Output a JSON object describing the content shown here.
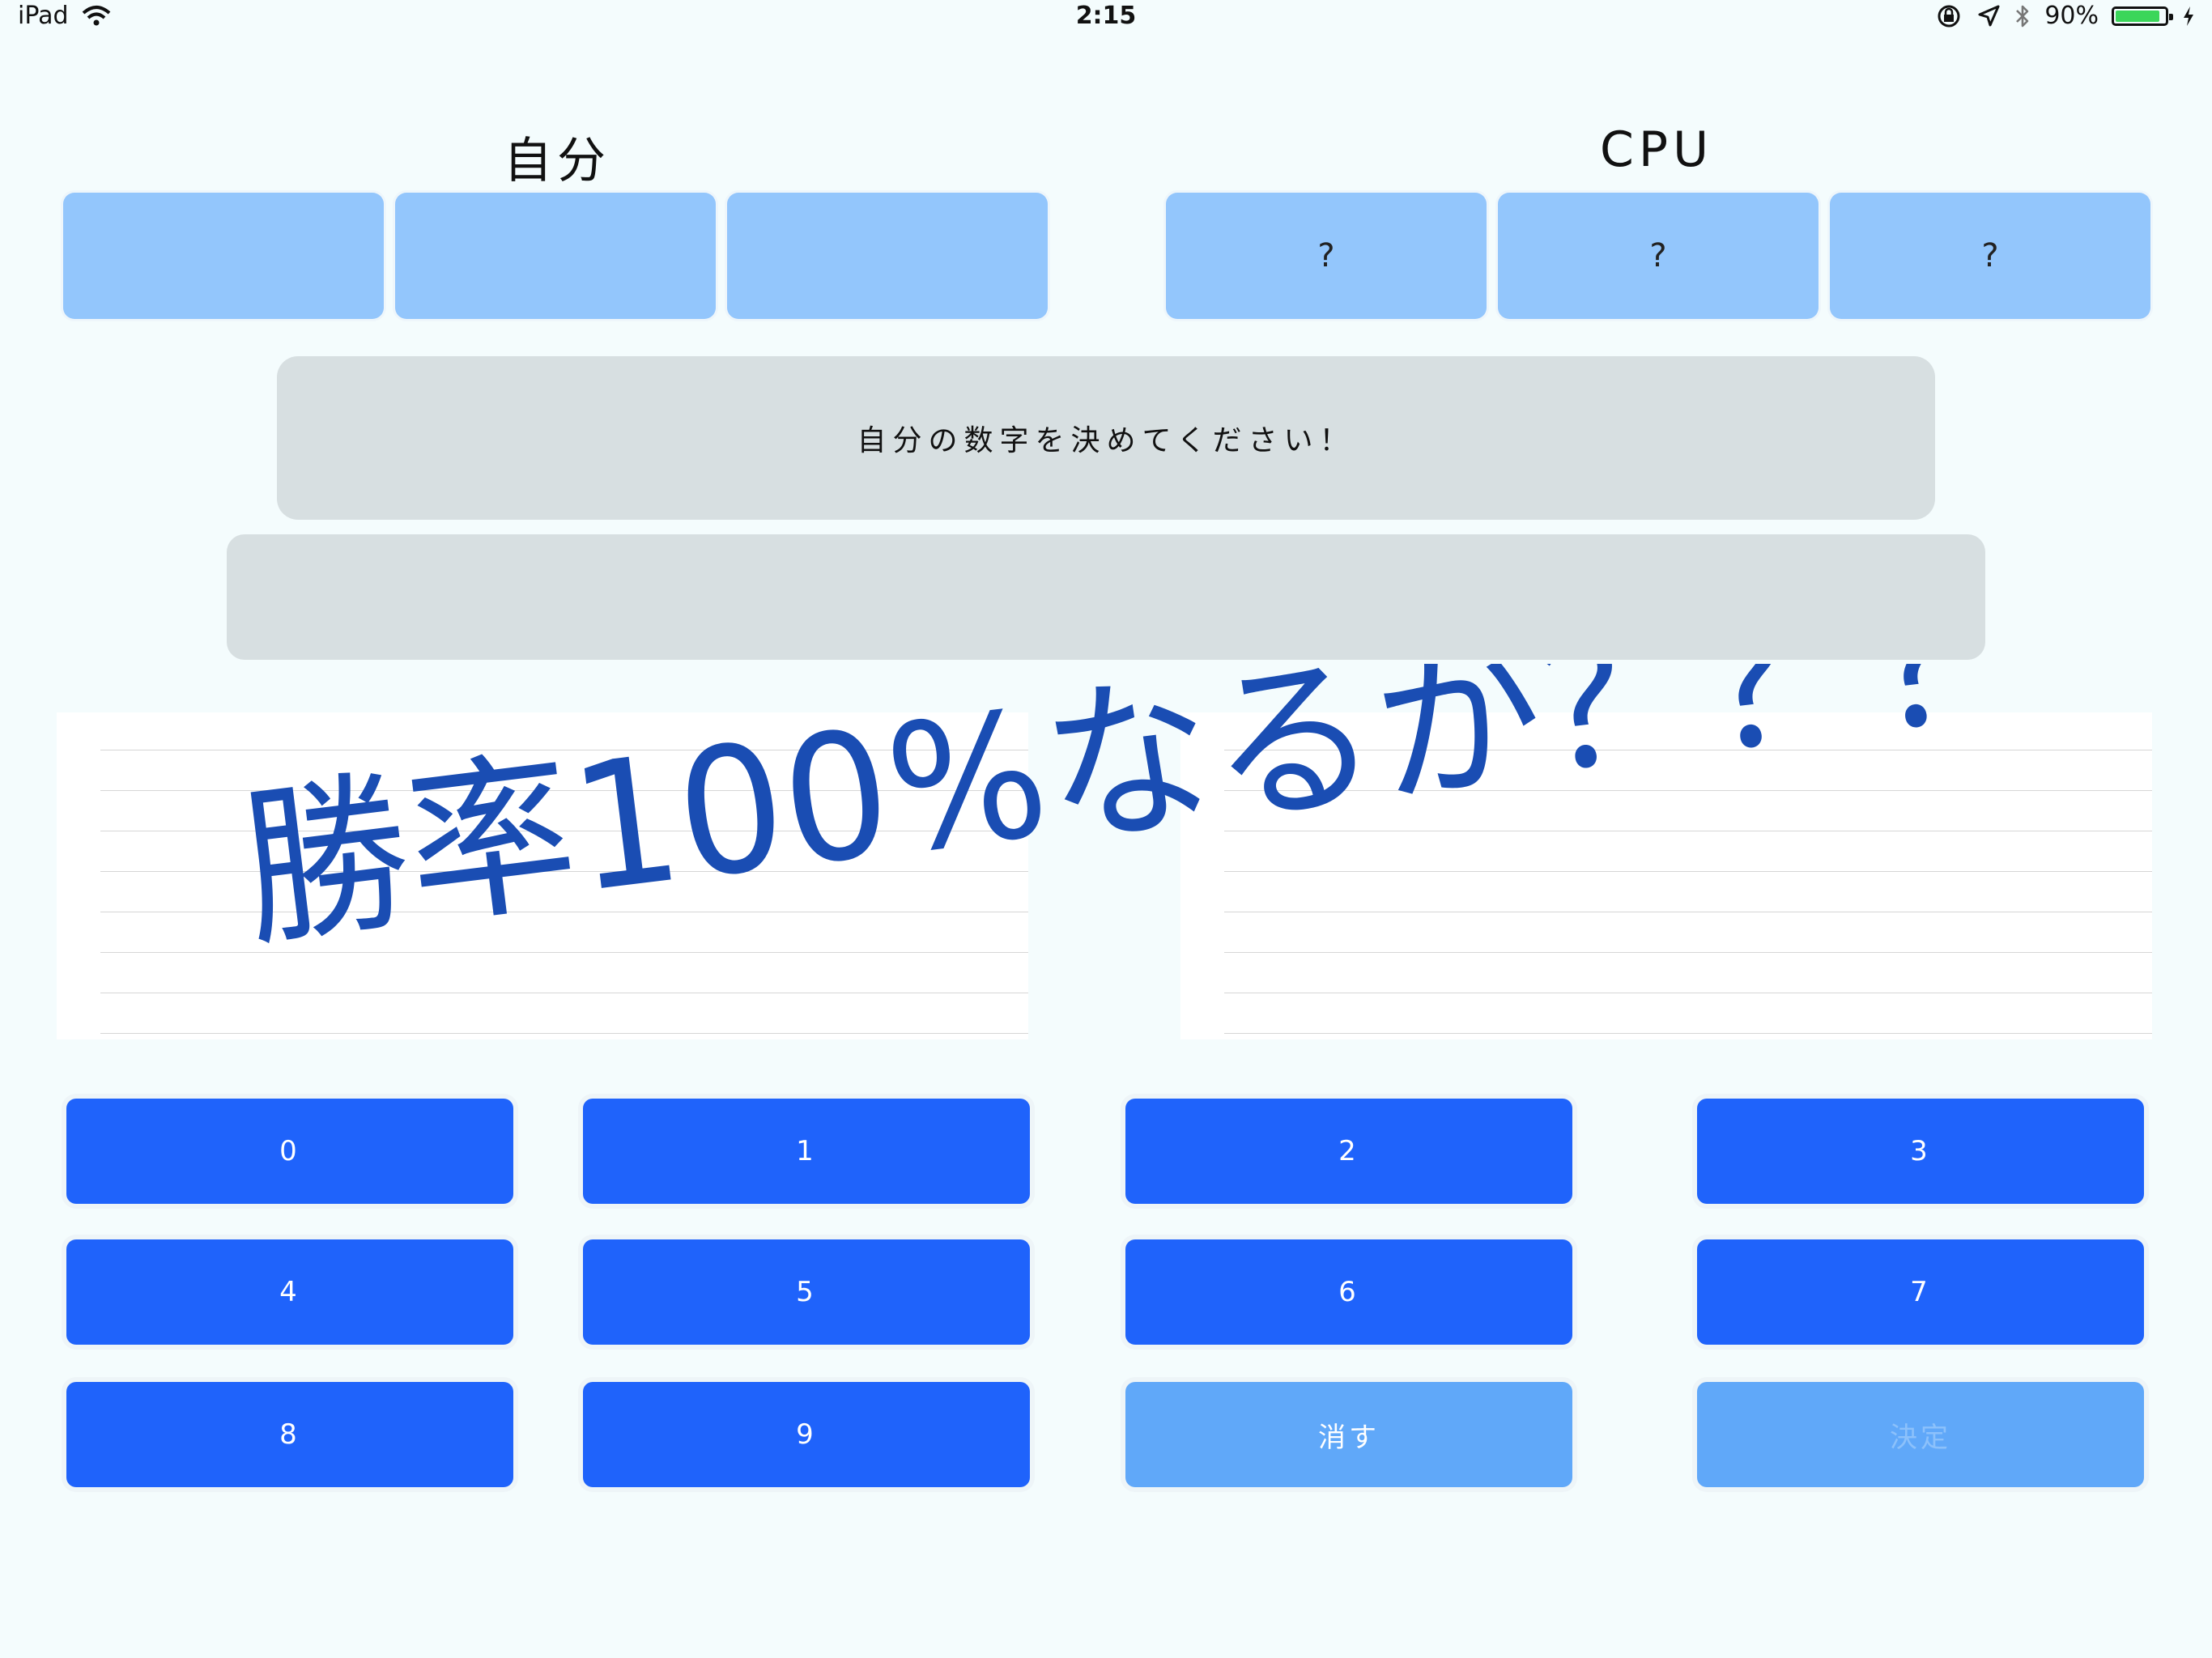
{
  "status_bar": {
    "device": "iPad",
    "time": "2:15",
    "battery": "90%",
    "battery_level": 0.9
  },
  "players": {
    "self_label": "自分",
    "cpu_label": "CPU",
    "self_digits": [
      "",
      "",
      ""
    ],
    "cpu_digits": [
      "?",
      "?",
      "?"
    ]
  },
  "messages": {
    "instruction": "自分の数字を決めてください！",
    "secondary": ""
  },
  "banner": {
    "text": "勝率100%なるか？？？",
    "color": "#1a4db3"
  },
  "keypad": {
    "keys": [
      "0",
      "1",
      "2",
      "3",
      "4",
      "5",
      "6",
      "7",
      "8",
      "9"
    ],
    "clear": "消す",
    "confirm": "決定"
  },
  "colors": {
    "key_blue": "#1f63fb",
    "key_light": "#60a8f9",
    "digit_box": "#93c6fc",
    "message_bg": "#d7dfe1"
  }
}
